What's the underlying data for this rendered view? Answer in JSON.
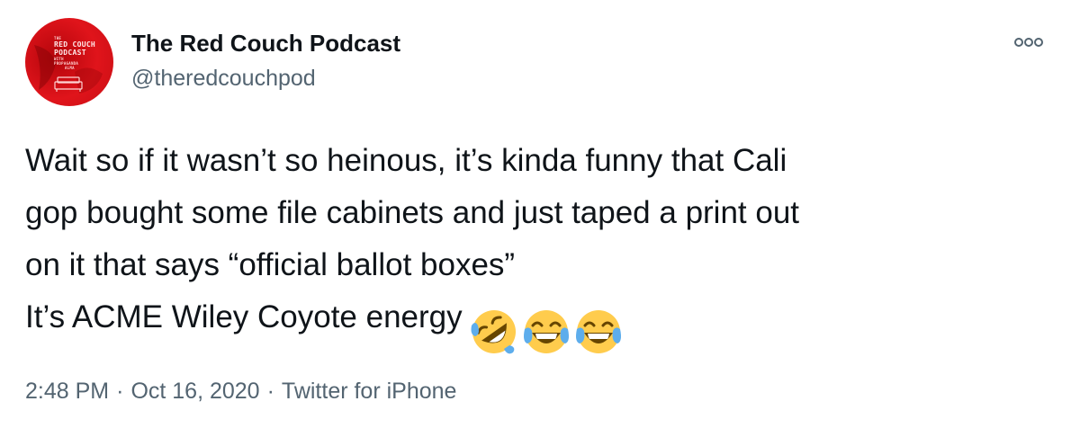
{
  "author": {
    "display_name": "The Red Couch Podcast",
    "handle": "@theredcouchpod",
    "avatar": {
      "top_small": "THE",
      "line1": "RED COUCH",
      "line2": "PODCAST",
      "line3": "WITH",
      "line4": "PROPAGANDA",
      "line5": "ALMA",
      "icon": "couch-icon",
      "background_color": "#e0141b"
    }
  },
  "more_icon": "more-options-icon",
  "tweet": {
    "lines": [
      "Wait so if it wasn’t so heinous, it’s kinda funny that Cali",
      "gop bought some file cabinets and just taped a print out",
      "on it that says “official ballot boxes”",
      "It’s ACME Wiley Coyote energy"
    ],
    "emojis": [
      "rolling-on-floor-laughing-emoji",
      "face-with-tears-of-joy-emoji",
      "face-with-tears-of-joy-emoji"
    ]
  },
  "meta": {
    "time": "2:48 PM",
    "separator": "·",
    "date": "Oct 16, 2020",
    "source": "Twitter for iPhone"
  },
  "colors": {
    "text": "#0f1419",
    "secondary": "#536471",
    "emoji_yellow": "#ffcc4d",
    "emoji_tear": "#5dadec"
  }
}
